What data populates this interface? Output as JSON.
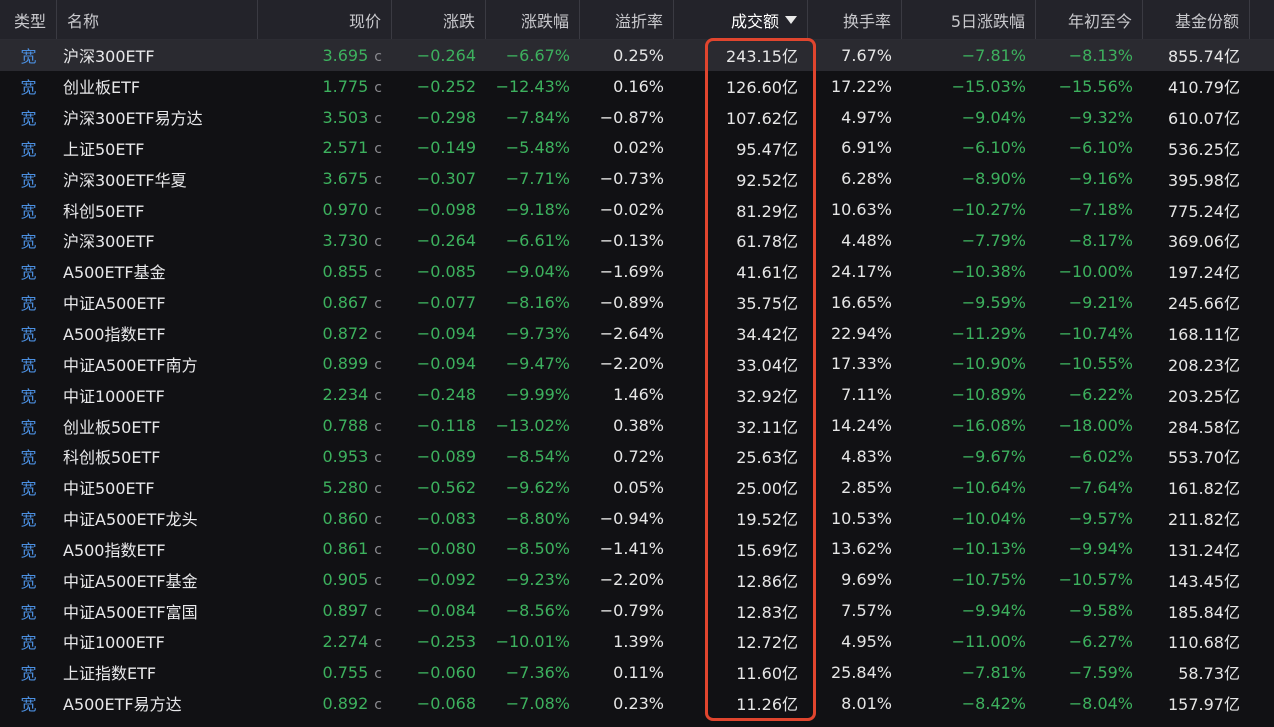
{
  "columns": {
    "type": "类型",
    "name": "名称",
    "price": "现价",
    "chg": "涨跌",
    "pct": "涨跌幅",
    "premium": "溢折率",
    "amount": "成交额",
    "turnover": "换手率",
    "d5": "5日涨跌幅",
    "ytd": "年初至今",
    "shares": "基金份额"
  },
  "sort": {
    "column": "amount",
    "direction": "desc",
    "icon": "triangle-down-icon"
  },
  "colors": {
    "down": "#3db15e",
    "type": "#4b8fe0",
    "highlight": "#e0452e",
    "selected_row": "#2a2a30"
  },
  "rows": [
    {
      "type": "宽",
      "name": "沪深300ETF",
      "price": "3.695",
      "marker": "c",
      "chg": "−0.264",
      "pct": "−6.67%",
      "premium": "0.25%",
      "amount": "243.15亿",
      "turnover": "7.67%",
      "d5": "−7.81%",
      "ytd": "−8.13%",
      "shares": "855.74亿",
      "selected": true
    },
    {
      "type": "宽",
      "name": "创业板ETF",
      "price": "1.775",
      "marker": "c",
      "chg": "−0.252",
      "pct": "−12.43%",
      "premium": "0.16%",
      "amount": "126.60亿",
      "turnover": "17.22%",
      "d5": "−15.03%",
      "ytd": "−15.56%",
      "shares": "410.79亿"
    },
    {
      "type": "宽",
      "name": "沪深300ETF易方达",
      "price": "3.503",
      "marker": "c",
      "chg": "−0.298",
      "pct": "−7.84%",
      "premium": "−0.87%",
      "amount": "107.62亿",
      "turnover": "4.97%",
      "d5": "−9.04%",
      "ytd": "−9.32%",
      "shares": "610.07亿"
    },
    {
      "type": "宽",
      "name": "上证50ETF",
      "price": "2.571",
      "marker": "c",
      "chg": "−0.149",
      "pct": "−5.48%",
      "premium": "0.02%",
      "amount": "95.47亿",
      "turnover": "6.91%",
      "d5": "−6.10%",
      "ytd": "−6.10%",
      "shares": "536.25亿"
    },
    {
      "type": "宽",
      "name": "沪深300ETF华夏",
      "price": "3.675",
      "marker": "c",
      "chg": "−0.307",
      "pct": "−7.71%",
      "premium": "−0.73%",
      "amount": "92.52亿",
      "turnover": "6.28%",
      "d5": "−8.90%",
      "ytd": "−9.16%",
      "shares": "395.98亿"
    },
    {
      "type": "宽",
      "name": "科创50ETF",
      "price": "0.970",
      "marker": "c",
      "chg": "−0.098",
      "pct": "−9.18%",
      "premium": "−0.02%",
      "amount": "81.29亿",
      "turnover": "10.63%",
      "d5": "−10.27%",
      "ytd": "−7.18%",
      "shares": "775.24亿"
    },
    {
      "type": "宽",
      "name": "沪深300ETF",
      "price": "3.730",
      "marker": "c",
      "chg": "−0.264",
      "pct": "−6.61%",
      "premium": "−0.13%",
      "amount": "61.78亿",
      "turnover": "4.48%",
      "d5": "−7.79%",
      "ytd": "−8.17%",
      "shares": "369.06亿"
    },
    {
      "type": "宽",
      "name": "A500ETF基金",
      "price": "0.855",
      "marker": "c",
      "chg": "−0.085",
      "pct": "−9.04%",
      "premium": "−1.69%",
      "amount": "41.61亿",
      "turnover": "24.17%",
      "d5": "−10.38%",
      "ytd": "−10.00%",
      "shares": "197.24亿"
    },
    {
      "type": "宽",
      "name": "中证A500ETF",
      "price": "0.867",
      "marker": "c",
      "chg": "−0.077",
      "pct": "−8.16%",
      "premium": "−0.89%",
      "amount": "35.75亿",
      "turnover": "16.65%",
      "d5": "−9.59%",
      "ytd": "−9.21%",
      "shares": "245.66亿"
    },
    {
      "type": "宽",
      "name": "A500指数ETF",
      "price": "0.872",
      "marker": "c",
      "chg": "−0.094",
      "pct": "−9.73%",
      "premium": "−2.64%",
      "amount": "34.42亿",
      "turnover": "22.94%",
      "d5": "−11.29%",
      "ytd": "−10.74%",
      "shares": "168.11亿"
    },
    {
      "type": "宽",
      "name": "中证A500ETF南方",
      "price": "0.899",
      "marker": "c",
      "chg": "−0.094",
      "pct": "−9.47%",
      "premium": "−2.20%",
      "amount": "33.04亿",
      "turnover": "17.33%",
      "d5": "−10.90%",
      "ytd": "−10.55%",
      "shares": "208.23亿"
    },
    {
      "type": "宽",
      "name": "中证1000ETF",
      "price": "2.234",
      "marker": "c",
      "chg": "−0.248",
      "pct": "−9.99%",
      "premium": "1.46%",
      "amount": "32.92亿",
      "turnover": "7.11%",
      "d5": "−10.89%",
      "ytd": "−6.22%",
      "shares": "203.25亿"
    },
    {
      "type": "宽",
      "name": "创业板50ETF",
      "price": "0.788",
      "marker": "c",
      "chg": "−0.118",
      "pct": "−13.02%",
      "premium": "0.38%",
      "amount": "32.11亿",
      "turnover": "14.24%",
      "d5": "−16.08%",
      "ytd": "−18.00%",
      "shares": "284.58亿"
    },
    {
      "type": "宽",
      "name": "科创板50ETF",
      "price": "0.953",
      "marker": "c",
      "chg": "−0.089",
      "pct": "−8.54%",
      "premium": "0.72%",
      "amount": "25.63亿",
      "turnover": "4.83%",
      "d5": "−9.67%",
      "ytd": "−6.02%",
      "shares": "553.70亿"
    },
    {
      "type": "宽",
      "name": "中证500ETF",
      "price": "5.280",
      "marker": "c",
      "chg": "−0.562",
      "pct": "−9.62%",
      "premium": "0.05%",
      "amount": "25.00亿",
      "turnover": "2.85%",
      "d5": "−10.64%",
      "ytd": "−7.64%",
      "shares": "161.82亿"
    },
    {
      "type": "宽",
      "name": "中证A500ETF龙头",
      "price": "0.860",
      "marker": "c",
      "chg": "−0.083",
      "pct": "−8.80%",
      "premium": "−0.94%",
      "amount": "19.52亿",
      "turnover": "10.53%",
      "d5": "−10.04%",
      "ytd": "−9.57%",
      "shares": "211.82亿"
    },
    {
      "type": "宽",
      "name": "A500指数ETF",
      "price": "0.861",
      "marker": "c",
      "chg": "−0.080",
      "pct": "−8.50%",
      "premium": "−1.41%",
      "amount": "15.69亿",
      "turnover": "13.62%",
      "d5": "−10.13%",
      "ytd": "−9.94%",
      "shares": "131.24亿"
    },
    {
      "type": "宽",
      "name": "中证A500ETF基金",
      "price": "0.905",
      "marker": "c",
      "chg": "−0.092",
      "pct": "−9.23%",
      "premium": "−2.20%",
      "amount": "12.86亿",
      "turnover": "9.69%",
      "d5": "−10.75%",
      "ytd": "−10.57%",
      "shares": "143.45亿"
    },
    {
      "type": "宽",
      "name": "中证A500ETF富国",
      "price": "0.897",
      "marker": "c",
      "chg": "−0.084",
      "pct": "−8.56%",
      "premium": "−0.79%",
      "amount": "12.83亿",
      "turnover": "7.57%",
      "d5": "−9.94%",
      "ytd": "−9.58%",
      "shares": "185.84亿"
    },
    {
      "type": "宽",
      "name": "中证1000ETF",
      "price": "2.274",
      "marker": "c",
      "chg": "−0.253",
      "pct": "−10.01%",
      "premium": "1.39%",
      "amount": "12.72亿",
      "turnover": "4.95%",
      "d5": "−11.00%",
      "ytd": "−6.27%",
      "shares": "110.68亿"
    },
    {
      "type": "宽",
      "name": "上证指数ETF",
      "price": "0.755",
      "marker": "c",
      "chg": "−0.060",
      "pct": "−7.36%",
      "premium": "0.11%",
      "amount": "11.60亿",
      "turnover": "25.84%",
      "d5": "−7.81%",
      "ytd": "−7.59%",
      "shares": "58.73亿"
    },
    {
      "type": "宽",
      "name": "A500ETF易方达",
      "price": "0.892",
      "marker": "c",
      "chg": "−0.068",
      "pct": "−7.08%",
      "premium": "0.23%",
      "amount": "11.26亿",
      "turnover": "8.01%",
      "d5": "−8.42%",
      "ytd": "−8.04%",
      "shares": "157.97亿"
    }
  ]
}
